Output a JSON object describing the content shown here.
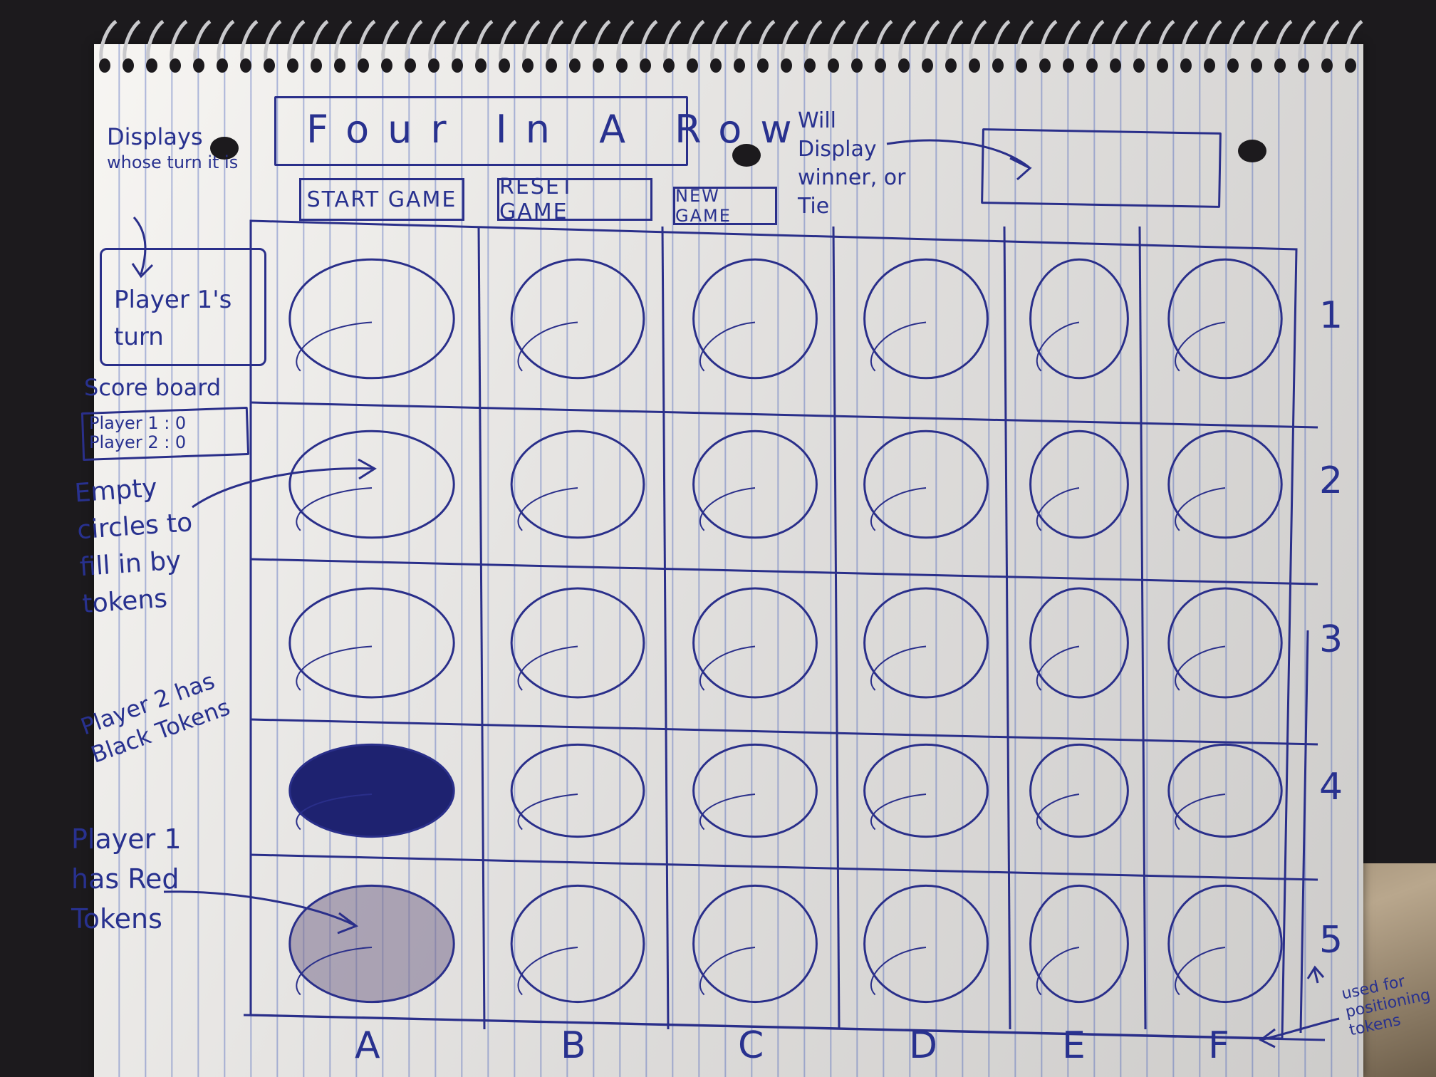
{
  "colors": {
    "ink": "#28318f",
    "paper": "#f4f2ee",
    "rule": "#465fb9",
    "player2_token": "#1e2270",
    "player1_token": "#7a6d8e"
  },
  "title": "Four In A Row",
  "buttons": {
    "start": "START GAME",
    "reset": "RESET GAME",
    "new_game": "NEW GAME"
  },
  "turn_display": {
    "text": "Player 1's turn"
  },
  "scoreboard": {
    "label": "Score board",
    "player1": "Player 1 : 0",
    "player2": "Player 2 : 0"
  },
  "annotations": {
    "turn_line1": "Displays",
    "turn_line2": "whose turn it is",
    "winner": "Will Display winner, or Tie",
    "empty": "Empty circles to fill in by tokens",
    "player2": "Player 2 has Black Tokens",
    "player1": "Player 1 has Red Tokens",
    "used": "used for positioning tokens"
  },
  "board": {
    "columns": [
      "A",
      "B",
      "C",
      "D",
      "E",
      "F"
    ],
    "rows": [
      "1",
      "2",
      "3",
      "4",
      "5"
    ],
    "cells": [
      [
        "empty",
        "empty",
        "empty",
        "empty",
        "empty",
        "empty"
      ],
      [
        "empty",
        "empty",
        "empty",
        "empty",
        "empty",
        "empty"
      ],
      [
        "empty",
        "empty",
        "empty",
        "empty",
        "empty",
        "empty"
      ],
      [
        "player2",
        "empty",
        "empty",
        "empty",
        "empty",
        "empty"
      ],
      [
        "player1",
        "empty",
        "empty",
        "empty",
        "empty",
        "empty"
      ]
    ]
  }
}
